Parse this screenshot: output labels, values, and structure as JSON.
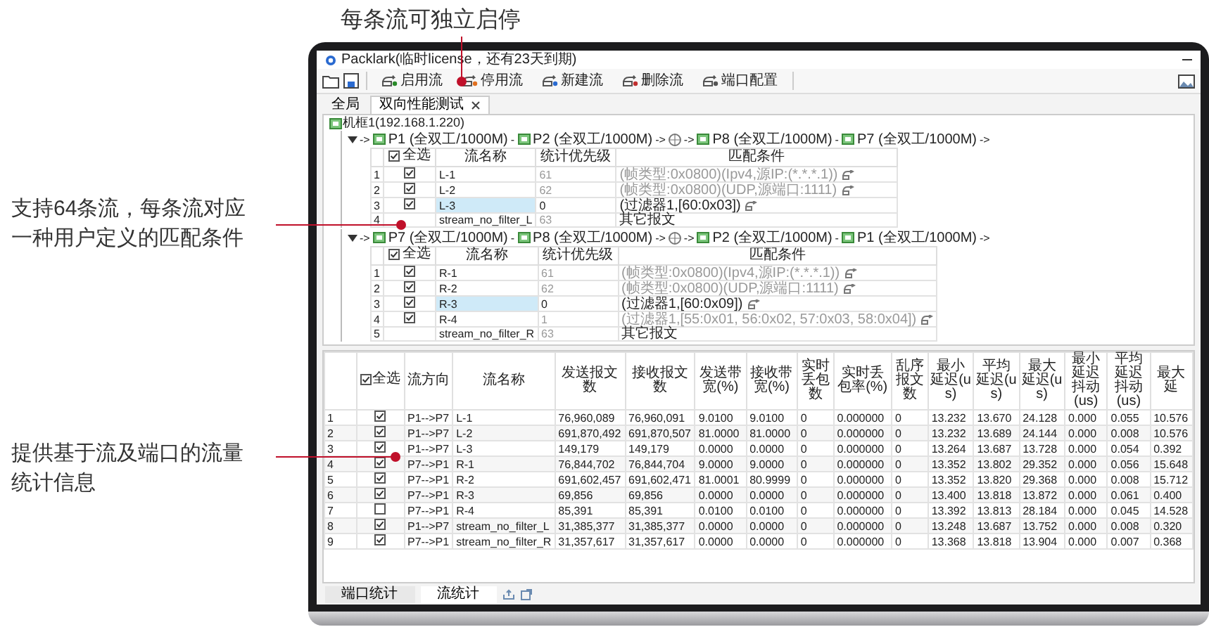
{
  "callouts": [
    "每条流可独立启停",
    "支持64条流，每条流对应一种用户定义的匹配条件",
    "提供基于流及端口的流量统计信息"
  ],
  "window": {
    "title": "Packlark(临时license，还有23天到期)"
  },
  "toolbar": [
    "启用流",
    "停用流",
    "新建流",
    "删除流",
    "端口配置"
  ],
  "tabs": [
    {
      "label": "全局",
      "selected": false,
      "closable": false
    },
    {
      "label": "双向性能测试",
      "selected": true,
      "closable": true
    }
  ],
  "tree_root": "机框1(192.168.1.220)",
  "stream_groups": [
    {
      "path": [
        {
          "kind": "text",
          "text": "->"
        },
        {
          "kind": "port",
          "text": "P1 (全双工/1000M)"
        },
        {
          "kind": "text",
          "text": "-"
        },
        {
          "kind": "port",
          "text": "P2 (全双工/1000M)"
        },
        {
          "kind": "text",
          "text": "->"
        },
        {
          "kind": "network"
        },
        {
          "kind": "text",
          "text": "->"
        },
        {
          "kind": "port",
          "text": "P8 (全双工/1000M)"
        },
        {
          "kind": "text",
          "text": "-"
        },
        {
          "kind": "port",
          "text": "P7 (全双工/1000M)"
        },
        {
          "kind": "text",
          "text": "->"
        }
      ],
      "select_all": {
        "label": "全选",
        "checked": true
      },
      "columns": [
        "流名称",
        "统计优先级",
        "匹配条件"
      ],
      "rows": [
        {
          "index": "1",
          "kind": "filter",
          "checked": true,
          "name": "L-1",
          "priority": "61",
          "condition": "(帧类型:0x0800)(Ipv4,源IP:(*.*.*.1))",
          "selected": false,
          "dimmed": true
        },
        {
          "index": "2",
          "kind": "filter",
          "checked": true,
          "name": "L-2",
          "priority": "62",
          "condition": "(帧类型:0x0800)(UDP,源端口:1111)",
          "selected": false,
          "dimmed": true
        },
        {
          "index": "3",
          "kind": "filter",
          "checked": true,
          "name": "L-3",
          "priority": "0",
          "condition": "(过滤器1,[60:0x03])",
          "selected": true,
          "dimmed": false
        },
        {
          "index": "4",
          "kind": "other",
          "name": "stream_no_filter_L",
          "priority": "63",
          "condition": "其它报文",
          "selected": false,
          "dimmed": false
        }
      ]
    },
    {
      "path": [
        {
          "kind": "text",
          "text": "->"
        },
        {
          "kind": "port",
          "text": "P7 (全双工/1000M)"
        },
        {
          "kind": "text",
          "text": "-"
        },
        {
          "kind": "port",
          "text": "P8 (全双工/1000M)"
        },
        {
          "kind": "text",
          "text": "->"
        },
        {
          "kind": "network"
        },
        {
          "kind": "text",
          "text": "->"
        },
        {
          "kind": "port",
          "text": "P2 (全双工/1000M)"
        },
        {
          "kind": "text",
          "text": "-"
        },
        {
          "kind": "port",
          "text": "P1 (全双工/1000M)"
        },
        {
          "kind": "text",
          "text": "->"
        }
      ],
      "select_all": {
        "label": "全选",
        "checked": true
      },
      "columns": [
        "流名称",
        "统计优先级",
        "匹配条件"
      ],
      "rows": [
        {
          "index": "1",
          "kind": "filter",
          "checked": true,
          "name": "R-1",
          "priority": "61",
          "condition": "(帧类型:0x0800)(Ipv4,源IP:(*.*.*.1))",
          "selected": false,
          "dimmed": true
        },
        {
          "index": "2",
          "kind": "filter",
          "checked": true,
          "name": "R-2",
          "priority": "62",
          "condition": "(帧类型:0x0800)(UDP,源端口:1111)",
          "selected": false,
          "dimmed": true
        },
        {
          "index": "3",
          "kind": "filter",
          "checked": true,
          "name": "R-3",
          "priority": "0",
          "condition": "(过滤器1,[60:0x09])",
          "selected": true,
          "dimmed": false
        },
        {
          "index": "4",
          "kind": "filter",
          "checked": true,
          "name": "R-4",
          "priority": "1",
          "condition": "(过滤器1,[55:0x01, 56:0x02, 57:0x03, 58:0x04])",
          "selected": false,
          "dimmed": true
        },
        {
          "index": "5",
          "kind": "other",
          "name": "stream_no_filter_R",
          "priority": "63",
          "condition": "其它报文",
          "selected": false,
          "dimmed": false
        }
      ]
    }
  ],
  "stats": {
    "select_all": {
      "label": "全选",
      "checked": true
    },
    "columns": [
      "流方向",
      "流名称",
      "发送报文数",
      "接收报文数",
      "发送带宽(%)",
      "接收带宽(%)",
      "实时丢包数",
      "实时丢包率(%)",
      "乱序报文数",
      "最小延迟(us)",
      "平均延迟(us)",
      "最大延迟(us)",
      "最小延迟抖动(us)",
      "平均延迟抖动(us)",
      "最大延"
    ],
    "rows": [
      {
        "index": "1",
        "checked": true,
        "cells": [
          "P1-->P7",
          "L-1",
          "76,960,089",
          "76,960,091",
          "9.0100",
          "9.0100",
          "0",
          "0.000000",
          "0",
          "13.232",
          "13.670",
          "24.128",
          "0.000",
          "0.055",
          "10.576"
        ]
      },
      {
        "index": "2",
        "checked": true,
        "cells": [
          "P1-->P7",
          "L-2",
          "691,870,492",
          "691,870,507",
          "81.0000",
          "81.0000",
          "0",
          "0.000000",
          "0",
          "13.232",
          "13.689",
          "24.144",
          "0.000",
          "0.008",
          "10.576"
        ]
      },
      {
        "index": "3",
        "checked": true,
        "cells": [
          "P1-->P7",
          "L-3",
          "149,179",
          "149,179",
          "0.0000",
          "0.0000",
          "0",
          "0.000000",
          "0",
          "13.264",
          "13.687",
          "13.728",
          "0.000",
          "0.054",
          "0.392"
        ]
      },
      {
        "index": "4",
        "checked": true,
        "cells": [
          "P7-->P1",
          "R-1",
          "76,844,702",
          "76,844,704",
          "9.0000",
          "9.0000",
          "0",
          "0.000000",
          "0",
          "13.352",
          "13.802",
          "29.352",
          "0.000",
          "0.056",
          "15.648"
        ]
      },
      {
        "index": "5",
        "checked": true,
        "cells": [
          "P7-->P1",
          "R-2",
          "691,602,457",
          "691,602,471",
          "81.0001",
          "80.9999",
          "0",
          "0.000000",
          "0",
          "13.352",
          "13.820",
          "29.368",
          "0.000",
          "0.008",
          "15.712"
        ]
      },
      {
        "index": "6",
        "checked": true,
        "cells": [
          "P7-->P1",
          "R-3",
          "69,856",
          "69,856",
          "0.0000",
          "0.0000",
          "0",
          "0.000000",
          "0",
          "13.400",
          "13.818",
          "13.872",
          "0.000",
          "0.061",
          "0.400"
        ]
      },
      {
        "index": "7",
        "checked": false,
        "cells": [
          "P7-->P1",
          "R-4",
          "85,391",
          "85,391",
          "0.0100",
          "0.0100",
          "0",
          "0.000000",
          "0",
          "13.392",
          "13.813",
          "28.184",
          "0.000",
          "0.045",
          "14.528"
        ]
      },
      {
        "index": "8",
        "checked": true,
        "cells": [
          "P1-->P7",
          "stream_no_filter_L",
          "31,385,377",
          "31,385,377",
          "0.0000",
          "0.0000",
          "0",
          "0.000000",
          "0",
          "13.248",
          "13.687",
          "13.752",
          "0.000",
          "0.008",
          "0.320"
        ]
      },
      {
        "index": "9",
        "checked": true,
        "cells": [
          "P7-->P1",
          "stream_no_filter_R",
          "31,357,617",
          "31,357,617",
          "0.0000",
          "0.0000",
          "0",
          "0.000000",
          "0",
          "13.368",
          "13.818",
          "13.904",
          "0.000",
          "0.007",
          "0.368"
        ]
      }
    ]
  },
  "bottom_tabs": [
    {
      "label": "端口统计",
      "selected": false
    },
    {
      "label": "流统计",
      "selected": true
    }
  ]
}
